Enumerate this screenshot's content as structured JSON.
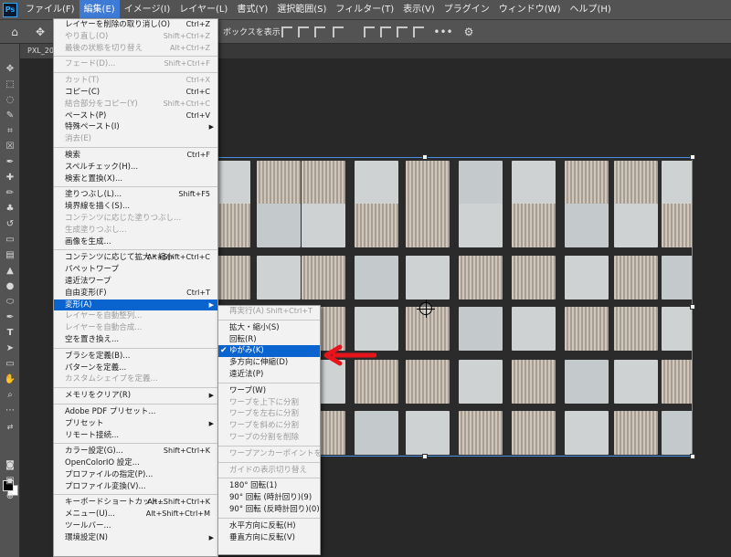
{
  "app": {
    "logo": "Ps"
  },
  "menubar": [
    "ファイル(F)",
    "編集(E)",
    "イメージ(I)",
    "レイヤー(L)",
    "書式(Y)",
    "選択範囲(S)",
    "フィルター(T)",
    "表示(V)",
    "プラグイン",
    "ウィンドウ(W)",
    "ヘルプ(H)"
  ],
  "options": {
    "show_box_text": "ボックスを表示"
  },
  "tab": {
    "label": "PXL_20"
  },
  "edit_menu": [
    {
      "label": "レイヤーを削除の取り消し(O)",
      "shortcut": "Ctrl+Z",
      "disabled": false
    },
    {
      "label": "やり直し(O)",
      "shortcut": "Shift+Ctrl+Z",
      "disabled": true
    },
    {
      "label": "最後の状態を切り替え",
      "shortcut": "Alt+Ctrl+Z",
      "disabled": true
    },
    {
      "sep": true
    },
    {
      "label": "フェード(D)...",
      "shortcut": "Shift+Ctrl+F",
      "disabled": true
    },
    {
      "sep": true
    },
    {
      "label": "カット(T)",
      "shortcut": "Ctrl+X",
      "disabled": true
    },
    {
      "label": "コピー(C)",
      "shortcut": "Ctrl+C",
      "disabled": false
    },
    {
      "label": "結合部分をコピー(Y)",
      "shortcut": "Shift+Ctrl+C",
      "disabled": true
    },
    {
      "label": "ペースト(P)",
      "shortcut": "Ctrl+V",
      "disabled": false
    },
    {
      "label": "特殊ペースト(I)",
      "shortcut": "",
      "disabled": false,
      "submenu": true
    },
    {
      "label": "消去(E)",
      "shortcut": "",
      "disabled": true
    },
    {
      "sep": true
    },
    {
      "label": "検索",
      "shortcut": "Ctrl+F",
      "disabled": false
    },
    {
      "label": "スペルチェック(H)...",
      "shortcut": "",
      "disabled": false
    },
    {
      "label": "検索と置換(X)...",
      "shortcut": "",
      "disabled": false
    },
    {
      "sep": true
    },
    {
      "label": "塗りつぶし(L)...",
      "shortcut": "Shift+F5",
      "disabled": false
    },
    {
      "label": "境界線を描く(S)...",
      "shortcut": "",
      "disabled": false
    },
    {
      "label": "コンテンツに応じた塗りつぶし...",
      "shortcut": "",
      "disabled": true
    },
    {
      "label": "生成塗りつぶし...",
      "shortcut": "",
      "disabled": true
    },
    {
      "label": "画像を生成...",
      "shortcut": "",
      "disabled": false
    },
    {
      "sep": true
    },
    {
      "label": "コンテンツに応じて拡大・縮小",
      "shortcut": "Alt+Shift+Ctrl+C",
      "disabled": false
    },
    {
      "label": "パペットワープ",
      "shortcut": "",
      "disabled": false
    },
    {
      "label": "遠近法ワープ",
      "shortcut": "",
      "disabled": false
    },
    {
      "label": "自由変形(F)",
      "shortcut": "Ctrl+T",
      "disabled": false
    },
    {
      "label": "変形(A)",
      "shortcut": "",
      "disabled": false,
      "submenu": true,
      "highlighted": true
    },
    {
      "label": "レイヤーを自動整列...",
      "shortcut": "",
      "disabled": true
    },
    {
      "label": "レイヤーを自動合成...",
      "shortcut": "",
      "disabled": true
    },
    {
      "label": "空を置き換え...",
      "shortcut": "",
      "disabled": false
    },
    {
      "sep": true
    },
    {
      "label": "ブラシを定義(B)...",
      "shortcut": "",
      "disabled": false
    },
    {
      "label": "パターンを定義...",
      "shortcut": "",
      "disabled": false
    },
    {
      "label": "カスタムシェイプを定義...",
      "shortcut": "",
      "disabled": true
    },
    {
      "sep": true
    },
    {
      "label": "メモリをクリア(R)",
      "shortcut": "",
      "disabled": false,
      "submenu": true
    },
    {
      "sep": true
    },
    {
      "label": "Adobe PDF プリセット...",
      "shortcut": "",
      "disabled": false
    },
    {
      "label": "プリセット",
      "shortcut": "",
      "disabled": false,
      "submenu": true
    },
    {
      "label": "リモート接続...",
      "shortcut": "",
      "disabled": false
    },
    {
      "sep": true
    },
    {
      "label": "カラー設定(G)...",
      "shortcut": "Shift+Ctrl+K",
      "disabled": false
    },
    {
      "label": "OpenColorIO 設定...",
      "shortcut": "",
      "disabled": false
    },
    {
      "label": "プロファイルの指定(P)...",
      "shortcut": "",
      "disabled": false
    },
    {
      "label": "プロファイル変換(V)...",
      "shortcut": "",
      "disabled": false
    },
    {
      "sep": true
    },
    {
      "label": "キーボードショートカット...",
      "shortcut": "Alt+Shift+Ctrl+K",
      "disabled": false
    },
    {
      "label": "メニュー(U)...",
      "shortcut": "Alt+Shift+Ctrl+M",
      "disabled": false
    },
    {
      "label": "ツールバー...",
      "shortcut": "",
      "disabled": false
    },
    {
      "label": "環境設定(N)",
      "shortcut": "",
      "disabled": false,
      "submenu": true
    }
  ],
  "transform_submenu": [
    {
      "label": "再実行(A)",
      "shortcut": "Shift+Ctrl+T",
      "disabled": true
    },
    {
      "sep": true
    },
    {
      "label": "拡大・縮小(S)",
      "disabled": false
    },
    {
      "label": "回転(R)",
      "disabled": false
    },
    {
      "label": "ゆがみ(K)",
      "disabled": false,
      "selected": true
    },
    {
      "label": "多方向に伸縮(D)",
      "disabled": false
    },
    {
      "label": "遠近法(P)",
      "disabled": false
    },
    {
      "sep": true
    },
    {
      "label": "ワープ(W)",
      "disabled": false
    },
    {
      "label": "ワープを上下に分割",
      "disabled": true
    },
    {
      "label": "ワープを左右に分割",
      "disabled": true
    },
    {
      "label": "ワープを斜めに分割",
      "disabled": true
    },
    {
      "label": "ワープの分割を削除",
      "disabled": true
    },
    {
      "sep": true
    },
    {
      "label": "ワープアンカーポイントを変換",
      "disabled": true
    },
    {
      "sep": true
    },
    {
      "label": "ガイドの表示切り替え",
      "disabled": true
    },
    {
      "sep": true
    },
    {
      "label": "180° 回転(1)",
      "disabled": false
    },
    {
      "label": "90° 回転 (時計回り)(9)",
      "disabled": false
    },
    {
      "label": "90° 回転 (反時計回り)(0)",
      "disabled": false
    },
    {
      "sep": true
    },
    {
      "label": "水平方向に反転(H)",
      "disabled": false
    },
    {
      "label": "垂直方向に反転(V)",
      "disabled": false
    }
  ],
  "colors": {
    "menu_highlight": "#0a64d0",
    "annotation_arrow": "#e8141b"
  }
}
